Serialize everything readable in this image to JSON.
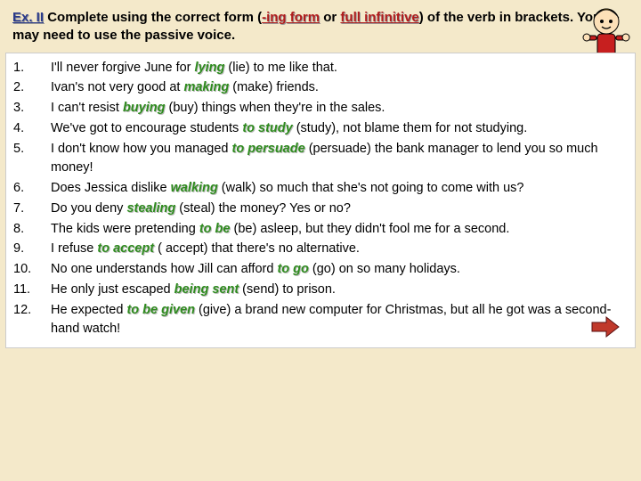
{
  "instruction": {
    "ex_label": "Ex. II",
    "part1": "  Complete using the correct form (",
    "ing_form": "-ing form",
    "part2": " or ",
    "full_inf": "full infinitive",
    "part3": ") of the verb in brackets. You may need to use the passive voice."
  },
  "items": [
    {
      "num": "1.",
      "pre": "I'll never forgive June for  ",
      "ans": "lying",
      "post": "   (lie) to me like that."
    },
    {
      "num": "2.",
      "pre": "Ivan's not very good at   ",
      "ans": "making",
      "post": "        (make) friends."
    },
    {
      "num": "3.",
      "pre": "I can't resist      ",
      "ans": "buying",
      "post": "      (buy) things when they're in the sales."
    },
    {
      "num": "4.",
      "pre": "We've got to encourage students  ",
      "ans": "to study",
      "post": "    (study), not blame them for not studying."
    },
    {
      "num": "5.",
      "pre": "I don't know how you managed   ",
      "ans": "to persuade",
      "post": "      (persuade) the bank manager to lend you so much money!"
    },
    {
      "num": "6.",
      "pre": "Does Jessica dislike    ",
      "ans": "walking",
      "post": "     (walk) so much that she's not going to come with us?"
    },
    {
      "num": "7.",
      "pre": "Do you deny  ",
      "ans": "stealing",
      "post": "      (steal) the money? Yes or no?"
    },
    {
      "num": "8.",
      "pre": "The kids were  pretending  ",
      "ans": "to be",
      "post": "   (be) asleep, but they didn't fool me for a second."
    },
    {
      "num": "9.",
      "pre": "I refuse    ",
      "ans": "to accept",
      "post": "   ( accept) that there's no alternative."
    },
    {
      "num": "10.",
      "pre": "No one understands how Jill can afford      ",
      "ans": "to go",
      "post": "     (go) on so many holidays."
    },
    {
      "num": "11.",
      "pre": "He only just escaped     ",
      "ans": "being sent",
      "post": "       (send) to prison."
    },
    {
      "num": "12.",
      "pre": "He expected      ",
      "ans": "to be given",
      "post": "               (give) a brand new computer for Christmas, but all he got was a second-hand watch!"
    }
  ]
}
